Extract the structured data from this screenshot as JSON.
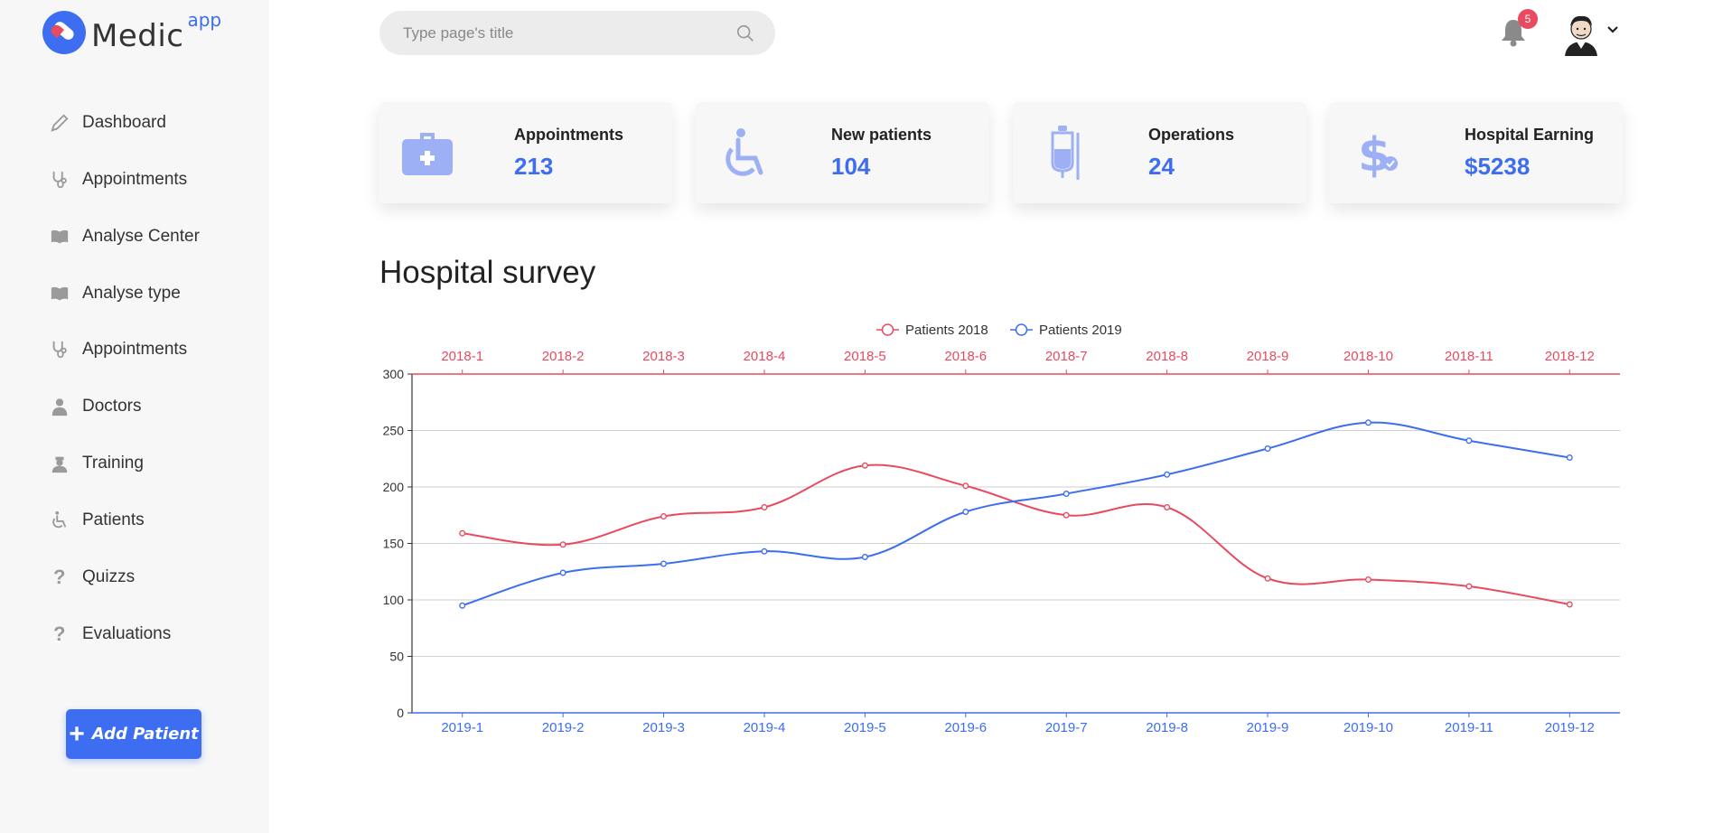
{
  "logo": {
    "text": "Medic",
    "sup": "app"
  },
  "nav": [
    {
      "label": "Dashboard",
      "icon": "pencil-icon"
    },
    {
      "label": "Appointments",
      "icon": "stethoscope-icon"
    },
    {
      "label": "Analyse Center",
      "icon": "book-icon"
    },
    {
      "label": "Analyse type",
      "icon": "book-icon"
    },
    {
      "label": "Appointments",
      "icon": "stethoscope-icon"
    },
    {
      "label": "Doctors",
      "icon": "doctor-icon"
    },
    {
      "label": "Training",
      "icon": "nurse-icon"
    },
    {
      "label": "Patients",
      "icon": "wheelchair-icon"
    },
    {
      "label": "Quizzs",
      "icon": "question-icon"
    },
    {
      "label": "Evaluations",
      "icon": "question-icon"
    }
  ],
  "add_button": {
    "label": "Add Patient"
  },
  "search": {
    "placeholder": "Type page's title",
    "value": ""
  },
  "notifications": {
    "count": "5"
  },
  "stats": [
    {
      "title": "Appointments",
      "value": "213",
      "icon": "medical-kit-icon"
    },
    {
      "title": "New patients",
      "value": "104",
      "icon": "wheelchair-icon"
    },
    {
      "title": "Operations",
      "value": "24",
      "icon": "iv-drip-icon"
    },
    {
      "title": "Hospital Earning",
      "value": "$5238",
      "icon": "dollar-check-icon"
    }
  ],
  "survey": {
    "title": "Hospital survey"
  },
  "colors": {
    "accent": "#3d6df0",
    "red": "#e84a5f",
    "icon_light": "#9db0f5"
  },
  "chart_data": {
    "type": "line",
    "title": "",
    "ylim": [
      0,
      300
    ],
    "yticks": [
      0,
      50,
      100,
      150,
      200,
      250,
      300
    ],
    "grid": true,
    "legend_position": "top-center",
    "series": [
      {
        "name": "Patients 2018",
        "color": "#e84a5f",
        "x": [
          "2018-1",
          "2018-2",
          "2018-3",
          "2018-4",
          "2018-5",
          "2018-6",
          "2018-7",
          "2018-8",
          "2018-9",
          "2018-10",
          "2018-11",
          "2018-12"
        ],
        "values": [
          159,
          149,
          174,
          182,
          219,
          201,
          175,
          182,
          119,
          118,
          112,
          96
        ]
      },
      {
        "name": "Patients 2019",
        "color": "#3d6df0",
        "x": [
          "2019-1",
          "2019-2",
          "2019-3",
          "2019-4",
          "2019-5",
          "2019-6",
          "2019-7",
          "2019-8",
          "2019-9",
          "2019-10",
          "2019-11",
          "2019-12"
        ],
        "values": [
          95,
          124,
          132,
          143,
          138,
          178,
          194,
          211,
          234,
          257,
          241,
          226
        ]
      }
    ]
  }
}
